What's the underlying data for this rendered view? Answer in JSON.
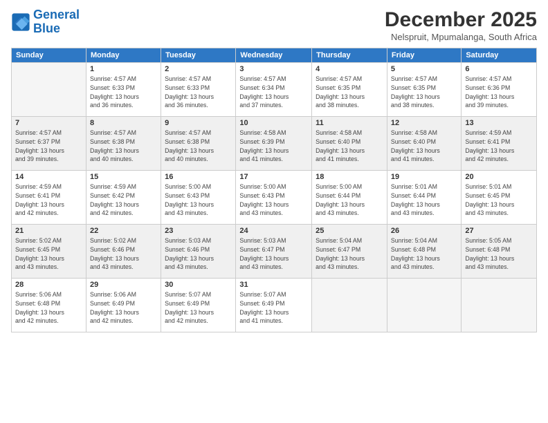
{
  "logo": {
    "line1": "General",
    "line2": "Blue"
  },
  "title": "December 2025",
  "location": "Nelspruit, Mpumalanga, South Africa",
  "weekdays": [
    "Sunday",
    "Monday",
    "Tuesday",
    "Wednesday",
    "Thursday",
    "Friday",
    "Saturday"
  ],
  "weeks": [
    [
      {
        "day": "",
        "info": ""
      },
      {
        "day": "1",
        "info": "Sunrise: 4:57 AM\nSunset: 6:33 PM\nDaylight: 13 hours\nand 36 minutes."
      },
      {
        "day": "2",
        "info": "Sunrise: 4:57 AM\nSunset: 6:33 PM\nDaylight: 13 hours\nand 36 minutes."
      },
      {
        "day": "3",
        "info": "Sunrise: 4:57 AM\nSunset: 6:34 PM\nDaylight: 13 hours\nand 37 minutes."
      },
      {
        "day": "4",
        "info": "Sunrise: 4:57 AM\nSunset: 6:35 PM\nDaylight: 13 hours\nand 38 minutes."
      },
      {
        "day": "5",
        "info": "Sunrise: 4:57 AM\nSunset: 6:35 PM\nDaylight: 13 hours\nand 38 minutes."
      },
      {
        "day": "6",
        "info": "Sunrise: 4:57 AM\nSunset: 6:36 PM\nDaylight: 13 hours\nand 39 minutes."
      }
    ],
    [
      {
        "day": "7",
        "info": "Sunrise: 4:57 AM\nSunset: 6:37 PM\nDaylight: 13 hours\nand 39 minutes."
      },
      {
        "day": "8",
        "info": "Sunrise: 4:57 AM\nSunset: 6:38 PM\nDaylight: 13 hours\nand 40 minutes."
      },
      {
        "day": "9",
        "info": "Sunrise: 4:57 AM\nSunset: 6:38 PM\nDaylight: 13 hours\nand 40 minutes."
      },
      {
        "day": "10",
        "info": "Sunrise: 4:58 AM\nSunset: 6:39 PM\nDaylight: 13 hours\nand 41 minutes."
      },
      {
        "day": "11",
        "info": "Sunrise: 4:58 AM\nSunset: 6:40 PM\nDaylight: 13 hours\nand 41 minutes."
      },
      {
        "day": "12",
        "info": "Sunrise: 4:58 AM\nSunset: 6:40 PM\nDaylight: 13 hours\nand 41 minutes."
      },
      {
        "day": "13",
        "info": "Sunrise: 4:59 AM\nSunset: 6:41 PM\nDaylight: 13 hours\nand 42 minutes."
      }
    ],
    [
      {
        "day": "14",
        "info": "Sunrise: 4:59 AM\nSunset: 6:41 PM\nDaylight: 13 hours\nand 42 minutes."
      },
      {
        "day": "15",
        "info": "Sunrise: 4:59 AM\nSunset: 6:42 PM\nDaylight: 13 hours\nand 42 minutes."
      },
      {
        "day": "16",
        "info": "Sunrise: 5:00 AM\nSunset: 6:43 PM\nDaylight: 13 hours\nand 43 minutes."
      },
      {
        "day": "17",
        "info": "Sunrise: 5:00 AM\nSunset: 6:43 PM\nDaylight: 13 hours\nand 43 minutes."
      },
      {
        "day": "18",
        "info": "Sunrise: 5:00 AM\nSunset: 6:44 PM\nDaylight: 13 hours\nand 43 minutes."
      },
      {
        "day": "19",
        "info": "Sunrise: 5:01 AM\nSunset: 6:44 PM\nDaylight: 13 hours\nand 43 minutes."
      },
      {
        "day": "20",
        "info": "Sunrise: 5:01 AM\nSunset: 6:45 PM\nDaylight: 13 hours\nand 43 minutes."
      }
    ],
    [
      {
        "day": "21",
        "info": "Sunrise: 5:02 AM\nSunset: 6:45 PM\nDaylight: 13 hours\nand 43 minutes."
      },
      {
        "day": "22",
        "info": "Sunrise: 5:02 AM\nSunset: 6:46 PM\nDaylight: 13 hours\nand 43 minutes."
      },
      {
        "day": "23",
        "info": "Sunrise: 5:03 AM\nSunset: 6:46 PM\nDaylight: 13 hours\nand 43 minutes."
      },
      {
        "day": "24",
        "info": "Sunrise: 5:03 AM\nSunset: 6:47 PM\nDaylight: 13 hours\nand 43 minutes."
      },
      {
        "day": "25",
        "info": "Sunrise: 5:04 AM\nSunset: 6:47 PM\nDaylight: 13 hours\nand 43 minutes."
      },
      {
        "day": "26",
        "info": "Sunrise: 5:04 AM\nSunset: 6:48 PM\nDaylight: 13 hours\nand 43 minutes."
      },
      {
        "day": "27",
        "info": "Sunrise: 5:05 AM\nSunset: 6:48 PM\nDaylight: 13 hours\nand 43 minutes."
      }
    ],
    [
      {
        "day": "28",
        "info": "Sunrise: 5:06 AM\nSunset: 6:48 PM\nDaylight: 13 hours\nand 42 minutes."
      },
      {
        "day": "29",
        "info": "Sunrise: 5:06 AM\nSunset: 6:49 PM\nDaylight: 13 hours\nand 42 minutes."
      },
      {
        "day": "30",
        "info": "Sunrise: 5:07 AM\nSunset: 6:49 PM\nDaylight: 13 hours\nand 42 minutes."
      },
      {
        "day": "31",
        "info": "Sunrise: 5:07 AM\nSunset: 6:49 PM\nDaylight: 13 hours\nand 41 minutes."
      },
      {
        "day": "",
        "info": ""
      },
      {
        "day": "",
        "info": ""
      },
      {
        "day": "",
        "info": ""
      }
    ]
  ]
}
